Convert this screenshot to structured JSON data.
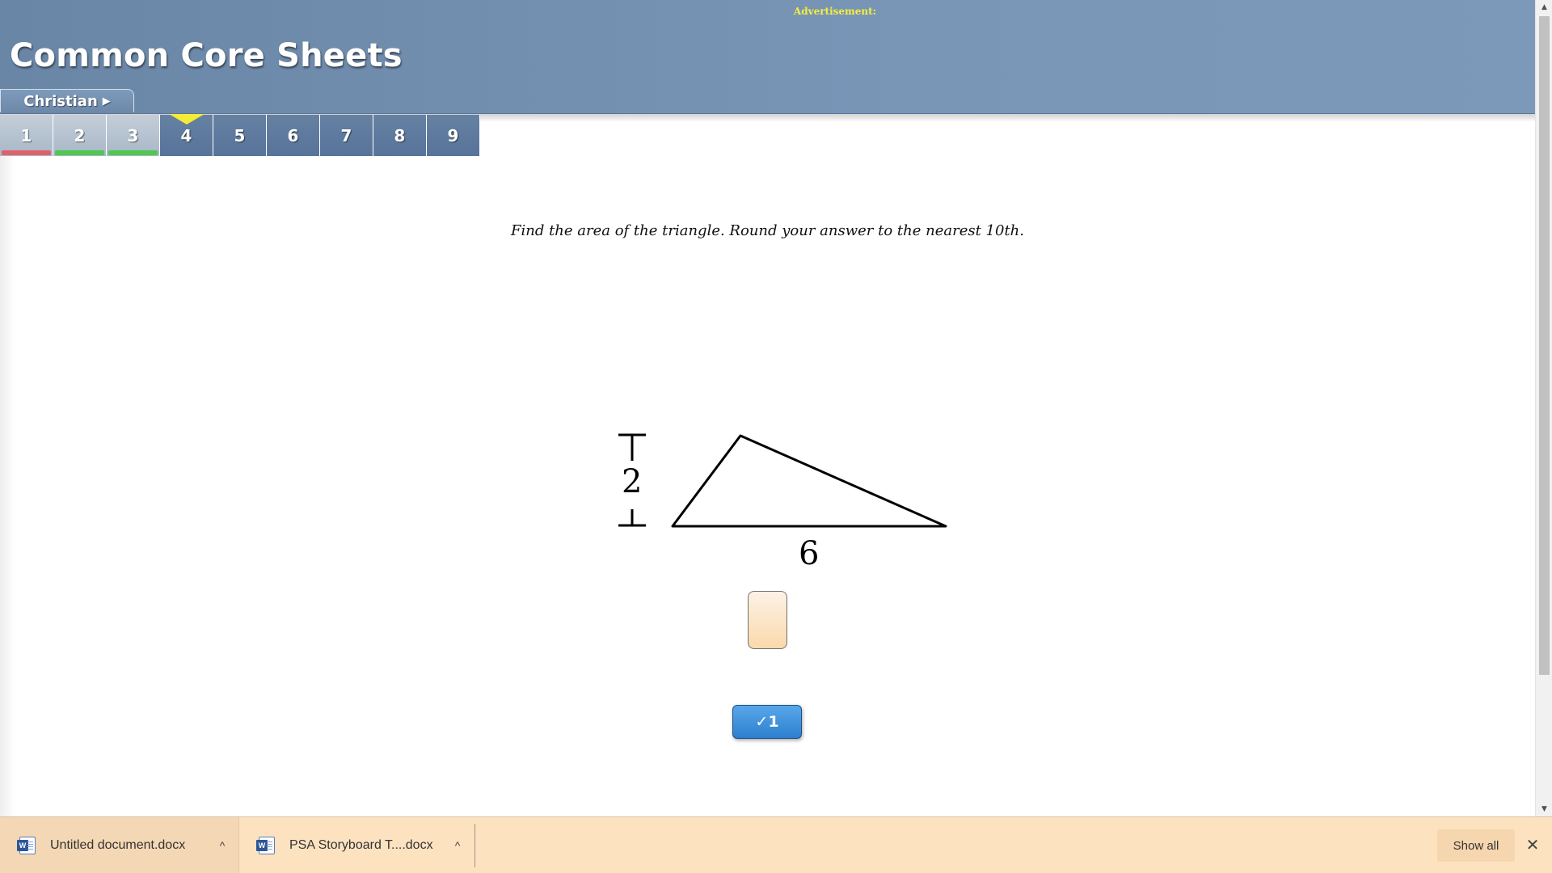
{
  "header": {
    "ad_label": "Advertisement:",
    "site_title": "Common Core Sheets",
    "user_name": "Christian",
    "user_arrow": "▶"
  },
  "question_tabs": [
    {
      "label": "1",
      "state": "done",
      "result": "incorrect",
      "result_color": "#e0616a"
    },
    {
      "label": "2",
      "state": "done",
      "result": "correct",
      "result_color": "#4fc84f"
    },
    {
      "label": "3",
      "state": "done",
      "result": "correct",
      "result_color": "#4fc84f"
    },
    {
      "label": "4",
      "state": "current"
    },
    {
      "label": "5",
      "state": "pending"
    },
    {
      "label": "6",
      "state": "pending"
    },
    {
      "label": "7",
      "state": "pending"
    },
    {
      "label": "8",
      "state": "pending"
    },
    {
      "label": "9",
      "state": "pending"
    }
  ],
  "question": {
    "prompt": "Find the area of the triangle. Round your answer to the nearest 10th.",
    "height_label": "2",
    "base_label": "6",
    "answer_value": "",
    "check_label": "✓1"
  },
  "downloads": {
    "items": [
      {
        "name": "Untitled document.docx",
        "icon": "word-doc-icon",
        "caret": "^"
      },
      {
        "name": "PSA Storyboard T....docx",
        "icon": "word-doc-icon",
        "caret": "^"
      }
    ],
    "show_all_label": "Show all",
    "close_label": "✕"
  },
  "scrollbar": {
    "up_glyph": "▲",
    "down_glyph": "▼"
  },
  "colors": {
    "header_blue": "#7190b1",
    "tab_marker": "#f4ec36",
    "check_button": "#3e90de",
    "download_bar": "#fde2c0"
  }
}
